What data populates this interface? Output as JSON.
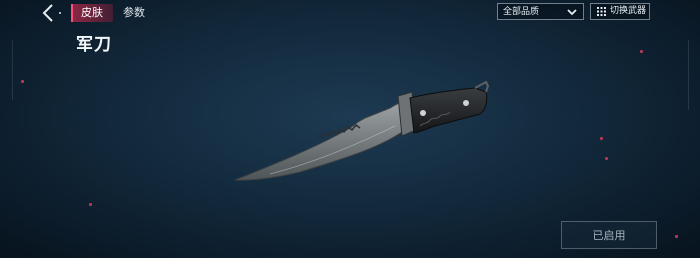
{
  "header": {
    "tabs": [
      {
        "label": "皮肤",
        "active": true
      },
      {
        "label": "参数",
        "active": false
      }
    ],
    "quality_filter": {
      "value": "全部品质"
    },
    "switch_weapon_label": "切换武器"
  },
  "weapon": {
    "name": "军刀"
  },
  "action": {
    "equipped_label": "已启用"
  },
  "colors": {
    "accent": "#b0284f",
    "background": "#132a3d"
  }
}
